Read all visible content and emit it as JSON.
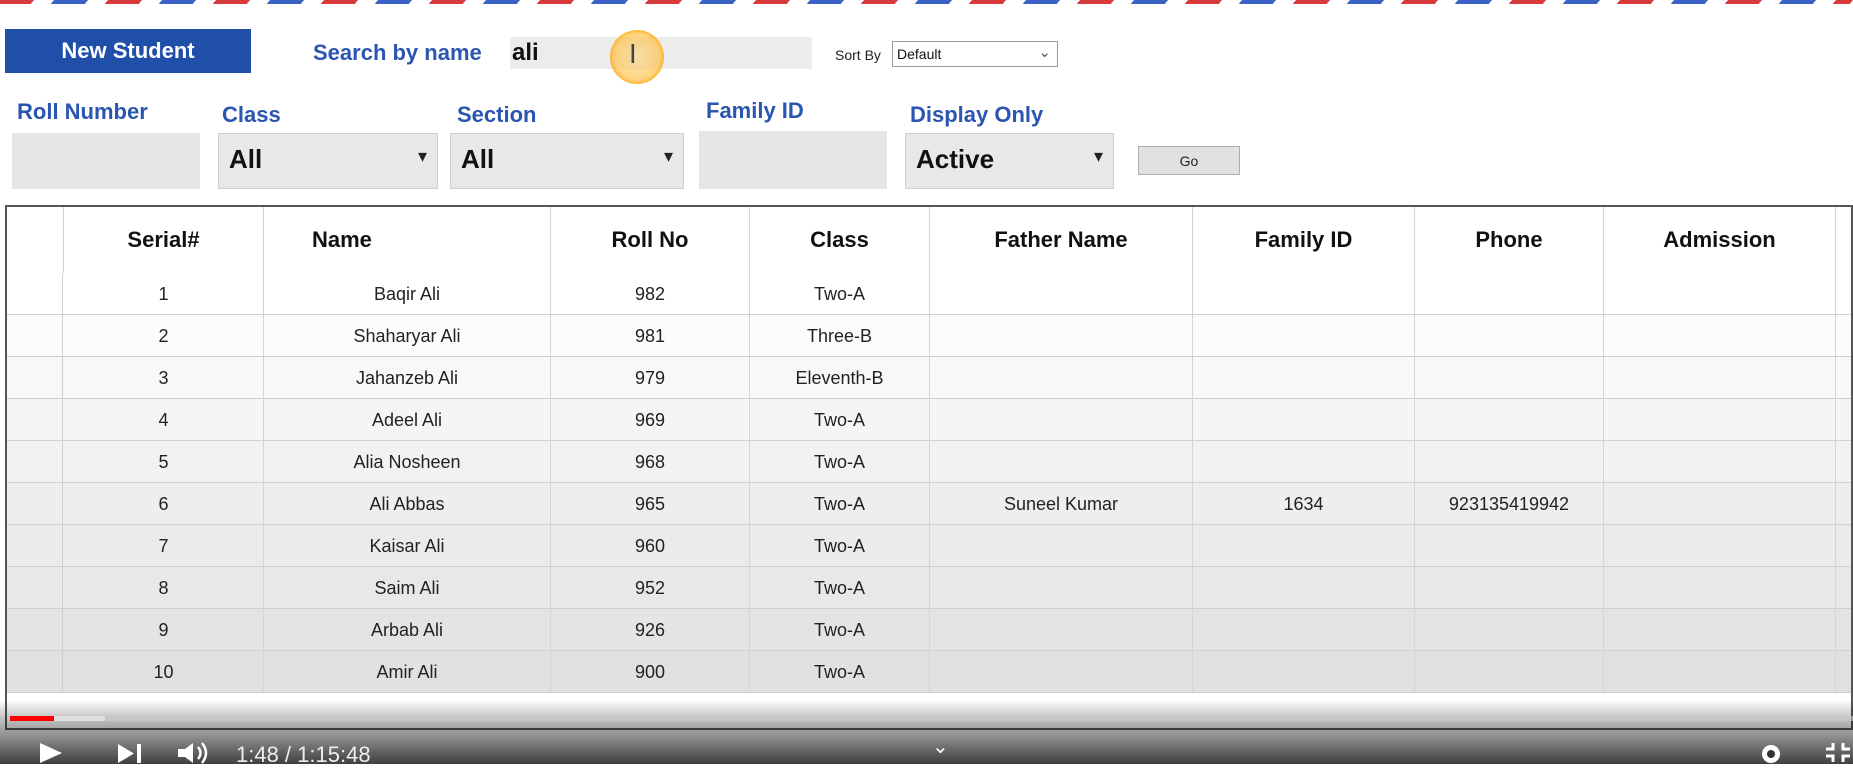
{
  "toolbar": {
    "new_student_label": "New Student",
    "search_label": "Search by name",
    "search_value": "ali",
    "sort_by_label": "Sort By",
    "sort_by_value": "Default"
  },
  "filters": {
    "roll_number_label": "Roll Number",
    "roll_number_value": "",
    "class_label": "Class",
    "class_value": "All",
    "section_label": "Section",
    "section_value": "All",
    "family_id_label": "Family ID",
    "family_id_value": "",
    "display_only_label": "Display Only",
    "display_only_value": "Active",
    "go_label": "Go"
  },
  "table": {
    "columns": [
      "Serial#",
      "Name",
      "Roll No",
      "Class",
      "Father Name",
      "Family ID",
      "Phone",
      "Admission"
    ],
    "rows": [
      [
        "1",
        "Baqir Ali",
        "982",
        "Two-A",
        "",
        "",
        "",
        ""
      ],
      [
        "2",
        "Shaharyar Ali",
        "981",
        "Three-B",
        "",
        "",
        "",
        ""
      ],
      [
        "3",
        "Jahanzeb Ali",
        "979",
        "Eleventh-B",
        "",
        "",
        "",
        ""
      ],
      [
        "4",
        "Adeel Ali",
        "969",
        "Two-A",
        "",
        "",
        "",
        ""
      ],
      [
        "5",
        "Alia Nosheen",
        "968",
        "Two-A",
        "",
        "",
        "",
        ""
      ],
      [
        "6",
        "Ali Abbas",
        "965",
        "Two-A",
        "Suneel Kumar",
        "1634",
        "923135419942",
        ""
      ],
      [
        "7",
        "Kaisar Ali",
        "960",
        "Two-A",
        "",
        "",
        "",
        ""
      ],
      [
        "8",
        "Saim Ali",
        "952",
        "Two-A",
        "",
        "",
        "",
        ""
      ],
      [
        "9",
        "Arbab Ali",
        "926",
        "Two-A",
        "",
        "",
        "",
        ""
      ],
      [
        "10",
        "Amir Ali",
        "900",
        "Two-A",
        "",
        "",
        "",
        ""
      ]
    ]
  },
  "player": {
    "time": "1:48 / 1:15:48",
    "progress_fraction": 0.024,
    "accent_color": "#ff0000"
  }
}
